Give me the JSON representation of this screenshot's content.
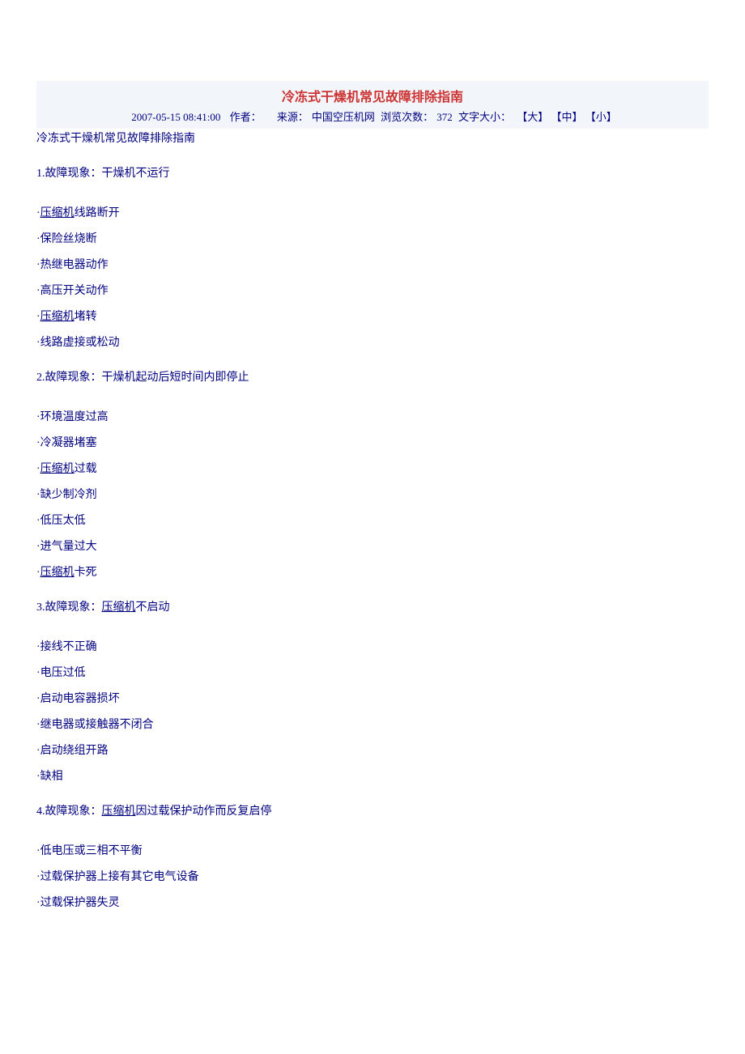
{
  "header": {
    "title": "冷冻式干燥机常见故障排除指南",
    "timestamp": "2007-05-15 08:41:00",
    "author_label": "作者：",
    "author_value": "",
    "source_label": "来源：",
    "source_value": "中国空压机网",
    "views_label": "浏览次数：",
    "views_value": "372",
    "font_label": "文字大小：",
    "font_large": "【大】",
    "font_medium": "【中】",
    "font_small": "【小】"
  },
  "subtitle": "冷冻式干燥机常见故障排除指南",
  "sections": [
    {
      "heading_pre": "1.故障现象：干燥机不运行",
      "heading_link": "",
      "heading_post": "",
      "bullets": [
        {
          "pre": "·",
          "link": "压缩机",
          "post": "线路断开"
        },
        {
          "pre": "·保险丝烧断",
          "link": "",
          "post": ""
        },
        {
          "pre": "·热继电器动作",
          "link": "",
          "post": ""
        },
        {
          "pre": "·高压开关动作",
          "link": "",
          "post": ""
        },
        {
          "pre": "·",
          "link": "压缩机",
          "post": "堵转"
        },
        {
          "pre": "·线路虚接或松动",
          "link": "",
          "post": ""
        }
      ]
    },
    {
      "heading_pre": "2.故障现象：干燥机起动后短时间内即停止",
      "heading_link": "",
      "heading_post": "",
      "bullets": [
        {
          "pre": "·环境温度过高",
          "link": "",
          "post": ""
        },
        {
          "pre": "·冷凝器堵塞",
          "link": "",
          "post": ""
        },
        {
          "pre": "·",
          "link": "压缩机",
          "post": "过载"
        },
        {
          "pre": "·缺少制冷剂",
          "link": "",
          "post": ""
        },
        {
          "pre": "·低压太低",
          "link": "",
          "post": ""
        },
        {
          "pre": "·进气量过大",
          "link": "",
          "post": ""
        },
        {
          "pre": "·",
          "link": "压缩机",
          "post": "卡死"
        }
      ]
    },
    {
      "heading_pre": "3.故障现象：",
      "heading_link": "压缩机",
      "heading_post": "不启动",
      "bullets": [
        {
          "pre": "·接线不正确",
          "link": "",
          "post": ""
        },
        {
          "pre": "·电压过低",
          "link": "",
          "post": ""
        },
        {
          "pre": "·启动电容器损坏",
          "link": "",
          "post": ""
        },
        {
          "pre": "·继电器或接触器不闭合",
          "link": "",
          "post": ""
        },
        {
          "pre": "·启动绕组开路",
          "link": "",
          "post": ""
        },
        {
          "pre": "·缺相",
          "link": "",
          "post": ""
        }
      ]
    },
    {
      "heading_pre": "4.故障现象：",
      "heading_link": "压缩机",
      "heading_post": "因过载保护动作而反复启停",
      "bullets": [
        {
          "pre": "·低电压或三相不平衡",
          "link": "",
          "post": ""
        },
        {
          "pre": "·过载保护器上接有其它电气设备",
          "link": "",
          "post": ""
        },
        {
          "pre": "·过载保护器失灵",
          "link": "",
          "post": ""
        }
      ]
    }
  ]
}
